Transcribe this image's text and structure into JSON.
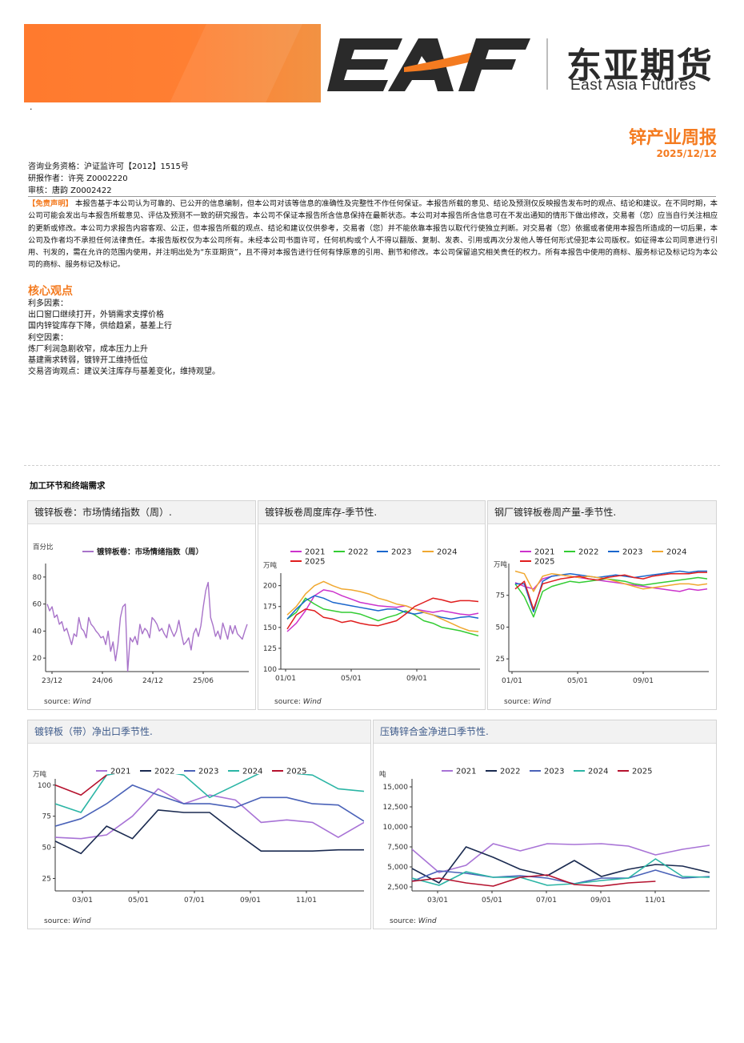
{
  "header": {
    "logo_text": "EAF",
    "brand_cn": "东亚期货",
    "brand_en": "East Asia Futures",
    "dot": "·",
    "report_title": "锌产业周报",
    "report_date": "2025/12/12"
  },
  "meta": {
    "license": "咨询业务资格：沪证监许可【2012】1515号",
    "author": "研报作者：许亮 Z0002220",
    "reviewer": "审核：唐韵 Z0002422"
  },
  "disclaimer": {
    "label": "【免责声明】",
    "text": "本报告基于本公司认为可靠的、已公开的信息编制，但本公司对该等信息的准确性及完整性不作任何保证。本报告所载的意见、结论及预测仅反映报告发布时的观点、结论和建议。在不同时期，本公司可能会发出与本报告所载意见、评估及预测不一致的研究报告。本公司不保证本报告所含信息保持在最新状态。本公司对本报告所含信息可在不发出通知的情形下做出修改，交易者（您）应当自行关注相应的更新或修改。本公司力求报告内容客观、公正，但本报告所载的观点、结论和建议仅供参考，交易者（您）并不能依靠本报告以取代行使独立判断。对交易者（您）依据或者使用本报告所造成的一切后果，本公司及作者均不承担任何法律责任。本报告版权仅为本公司所有。未经本公司书面许可，任何机构或个人不得以翻版、复制、发表、引用或再次分发他人等任何形式侵犯本公司版权。如征得本公司同意进行引用、刊发的，需在允许的范围内使用，并注明出处为“东亚期货”，且不得对本报告进行任何有悖原意的引用、删节和修改。本公司保留追究相关责任的权力。所有本报告中使用的商标、服务标记及标记均为本公司的商标、服务标记及标记。"
  },
  "core_view": {
    "heading": "核心观点",
    "lines": [
      "利多因素：",
      "出口窗口继续打开，外销需求支撑价格",
      "国内锌锭库存下降，供给趋紧，基差上行",
      "利空因素：",
      "炼厂利润急剧收窄，成本压力上升",
      "基建需求转弱，镀锌开工维持低位",
      "交易咨询观点：建议关注库存与基差变化，维持观望。"
    ]
  },
  "section_heading": "加工环节和终端需求",
  "source_label": "source:",
  "source_name": "Wind",
  "colors": {
    "accent": "#f47b20",
    "y2021": "#cc33cc",
    "y2022": "#33cc33",
    "y2023": "#1a66cc",
    "y2024": "#f0a830",
    "y2025": "#e01e1e",
    "b2021": "#a873d6",
    "b2022": "#1a2a50",
    "b2023": "#4a62b8",
    "b2024": "#2bb5a5",
    "b2025": "#b5122e",
    "sentiment": "#a873c9"
  },
  "chart_data": [
    {
      "type": "line",
      "title": "镀锌板卷：市场情绪指数（周）.",
      "ylabel": "百分比",
      "ylim": [
        10,
        90
      ],
      "yticks": [
        20,
        40,
        60,
        80
      ],
      "xticks": [
        "23/12",
        "24/06",
        "24/12",
        "25/06"
      ],
      "series": [
        {
          "name": "镀锌板卷：市场情绪指数（周）",
          "values": [
            60,
            55,
            58,
            50,
            52,
            45,
            47,
            40,
            42,
            36,
            30,
            38,
            36,
            50,
            42,
            40,
            35,
            50,
            45,
            43,
            40,
            38,
            35,
            36,
            30,
            40,
            25,
            32,
            18,
            30,
            50,
            58,
            60,
            10,
            35,
            32,
            36,
            30,
            45,
            38,
            42,
            40,
            35,
            50,
            48,
            45,
            40,
            42,
            38,
            35,
            45,
            40,
            36,
            40,
            48,
            38,
            30,
            32,
            35,
            26,
            38,
            42,
            36,
            44,
            58,
            70,
            76,
            50,
            44,
            36,
            40,
            34,
            46,
            40,
            34,
            44,
            38,
            44,
            38,
            36,
            34,
            40,
            45
          ]
        }
      ]
    },
    {
      "type": "line",
      "title": "镀锌板卷周度库存-季节性.",
      "ylabel": "万吨",
      "ylim": [
        100,
        215
      ],
      "yticks": [
        100,
        125,
        150,
        175,
        200
      ],
      "xticks": [
        "01/01",
        "05/01",
        "09/01"
      ],
      "series": [
        {
          "name": "2021",
          "values": [
            145,
            155,
            170,
            188,
            195,
            193,
            188,
            184,
            180,
            178,
            176,
            175,
            174,
            176,
            172,
            170,
            168,
            170,
            168,
            166,
            165,
            167
          ]
        },
        {
          "name": "2022",
          "values": [
            160,
            168,
            185,
            178,
            172,
            170,
            168,
            168,
            166,
            162,
            158,
            162,
            165,
            170,
            165,
            158,
            155,
            150,
            148,
            146,
            143,
            140
          ]
        },
        {
          "name": "2023",
          "values": [
            160,
            172,
            182,
            188,
            185,
            180,
            178,
            176,
            174,
            172,
            170,
            172,
            172,
            168,
            166,
            168,
            165,
            162,
            160,
            162,
            163,
            161
          ]
        },
        {
          "name": "2024",
          "values": [
            165,
            175,
            190,
            200,
            205,
            200,
            196,
            195,
            193,
            190,
            185,
            182,
            178,
            176,
            172,
            168,
            165,
            160,
            155,
            150,
            146,
            145
          ]
        },
        {
          "name": "2025",
          "values": [
            148,
            165,
            172,
            170,
            162,
            160,
            156,
            158,
            155,
            153,
            152,
            155,
            158,
            166,
            175,
            180,
            185,
            183,
            180,
            182,
            182,
            181
          ]
        }
      ]
    },
    {
      "type": "line",
      "title": "钢厂镀锌板卷周产量-季节性.",
      "ylabel": "万吨",
      "ylim": [
        15,
        100
      ],
      "yticks": [
        25,
        50,
        75
      ],
      "xticks": [
        "01/01",
        "05/01",
        "09/01"
      ],
      "series": [
        {
          "name": "2021",
          "values": [
            85,
            82,
            80,
            88,
            90,
            91,
            90,
            89,
            88,
            87,
            86,
            85,
            84,
            83,
            82,
            81,
            80,
            79,
            78,
            80,
            79,
            80
          ]
        },
        {
          "name": "2022",
          "values": [
            84,
            74,
            58,
            78,
            82,
            84,
            86,
            85,
            86,
            87,
            88,
            87,
            86,
            84,
            83,
            84,
            85,
            86,
            87,
            88,
            89,
            88
          ]
        },
        {
          "name": "2023",
          "values": [
            84,
            84,
            62,
            86,
            90,
            91,
            92,
            91,
            90,
            89,
            90,
            91,
            90,
            89,
            90,
            91,
            92,
            93,
            94,
            93,
            94,
            94
          ]
        },
        {
          "name": "2024",
          "values": [
            94,
            92,
            78,
            90,
            92,
            91,
            90,
            89,
            90,
            89,
            88,
            86,
            84,
            82,
            80,
            81,
            82,
            83,
            84,
            84,
            83,
            84
          ]
        },
        {
          "name": "2025",
          "values": [
            80,
            86,
            64,
            84,
            86,
            88,
            89,
            90,
            88,
            87,
            89,
            90,
            91,
            89,
            88,
            90,
            91,
            92,
            92,
            92,
            93,
            93
          ]
        }
      ]
    },
    {
      "type": "line",
      "title": "镀锌板（带）净出口季节性.",
      "ylabel": "万吨",
      "ylim": [
        15,
        105
      ],
      "yticks": [
        25,
        50,
        75,
        100
      ],
      "xticks": [
        "03/01",
        "05/01",
        "07/01",
        "09/01",
        "11/01"
      ],
      "series": [
        {
          "name": "2021",
          "values": [
            58,
            57,
            60,
            75,
            97,
            85,
            92,
            88,
            70,
            72,
            70,
            58,
            70
          ]
        },
        {
          "name": "2022",
          "values": [
            55,
            45,
            67,
            57,
            80,
            78,
            78,
            62,
            47,
            47,
            47,
            48,
            48
          ]
        },
        {
          "name": "2023",
          "values": [
            67,
            73,
            85,
            100,
            92,
            85,
            85,
            82,
            90,
            90,
            85,
            84,
            71
          ]
        },
        {
          "name": "2024",
          "values": [
            85,
            78,
            108,
            112,
            112,
            108,
            90,
            100,
            110,
            110,
            108,
            97,
            95
          ]
        },
        {
          "name": "2025",
          "values": [
            100,
            92,
            108
          ]
        }
      ]
    },
    {
      "type": "line",
      "title": "压铸锌合金净进口季节性.",
      "ylabel": "吨",
      "ylim": [
        2000,
        16000
      ],
      "yticks": [
        2500,
        5000,
        7500,
        10000,
        12500,
        15000
      ],
      "xticks": [
        "03/01",
        "05/01",
        "07/01",
        "09/01",
        "11/01"
      ],
      "series": [
        {
          "name": "2021",
          "values": [
            7200,
            4300,
            5200,
            7900,
            7000,
            7900,
            7800,
            7900,
            7600,
            6500,
            7200,
            7700
          ]
        },
        {
          "name": "2022",
          "values": [
            4800,
            3000,
            7500,
            6200,
            4700,
            3900,
            5800,
            3800,
            4700,
            5300,
            5100,
            4300
          ]
        },
        {
          "name": "2023",
          "values": [
            3200,
            4500,
            4200,
            3700,
            3900,
            3600,
            2900,
            3600,
            3600,
            4600,
            3600,
            3800
          ]
        },
        {
          "name": "2024",
          "values": [
            3600,
            2700,
            4400,
            3700,
            3700,
            2700,
            2900,
            3300,
            3600,
            6000,
            3800,
            3700
          ]
        },
        {
          "name": "2025",
          "values": [
            3200,
            3600,
            3000,
            2600,
            3700,
            4000,
            2800,
            2600,
            3000,
            3200
          ]
        }
      ]
    }
  ]
}
